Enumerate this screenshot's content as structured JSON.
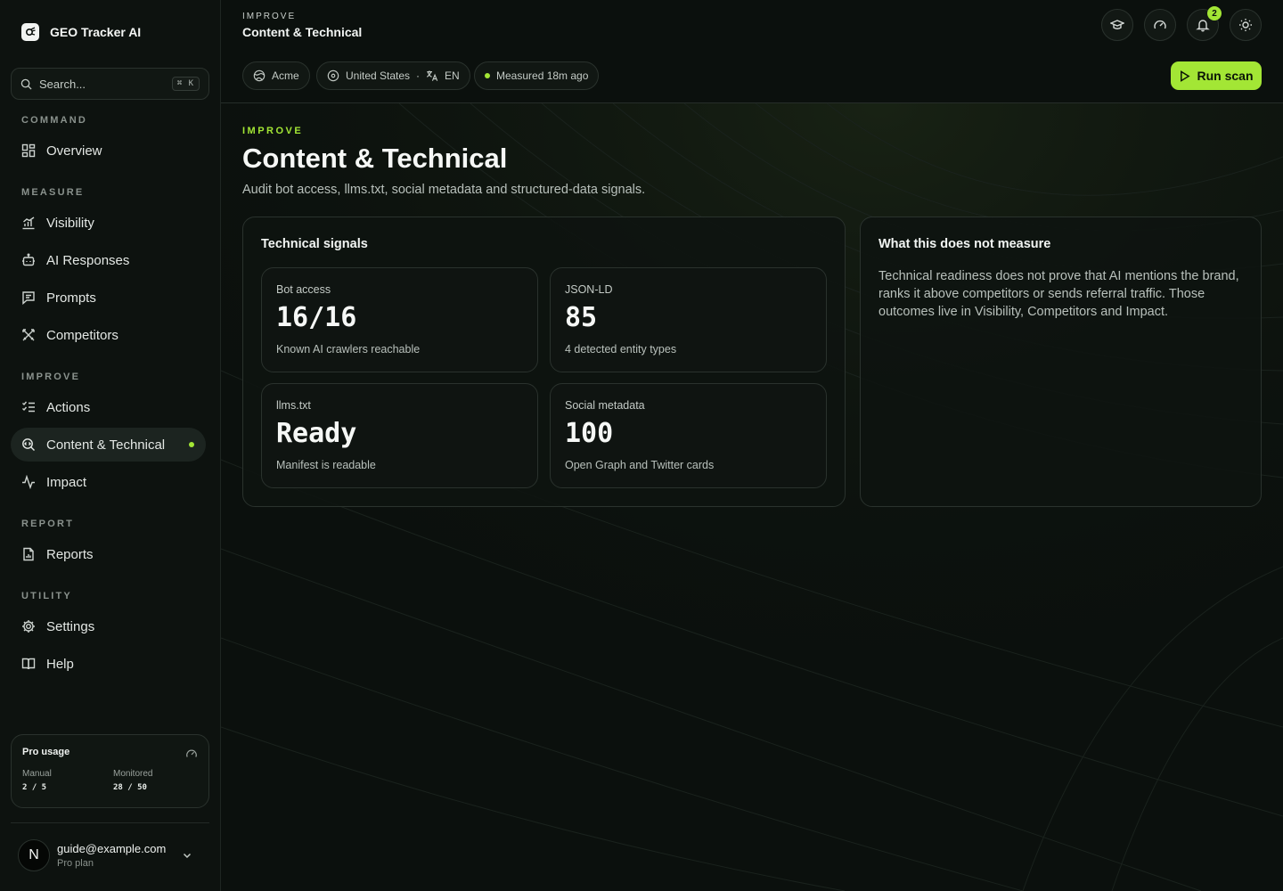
{
  "app": {
    "name": "GEO Tracker AI"
  },
  "search": {
    "placeholder": "Search...",
    "shortcut": "⌘ K"
  },
  "sidebar": {
    "sections": {
      "command": "COMMAND",
      "measure": "MEASURE",
      "improve": "IMPROVE",
      "report": "REPORT",
      "utility": "UTILITY"
    },
    "items": {
      "overview": "Overview",
      "visibility": "Visibility",
      "ai_responses": "AI Responses",
      "prompts": "Prompts",
      "competitors": "Competitors",
      "actions": "Actions",
      "content_technical": "Content & Technical",
      "impact": "Impact",
      "reports": "Reports",
      "settings": "Settings",
      "help": "Help"
    },
    "active_item": "content_technical"
  },
  "usage": {
    "title": "Pro usage",
    "manual_label": "Manual",
    "manual_value": "2 / 5",
    "monitored_label": "Monitored",
    "monitored_value": "28 / 50"
  },
  "user": {
    "initial": "N",
    "email": "guide@example.com",
    "plan": "Pro plan"
  },
  "header": {
    "eyebrow": "IMPROVE",
    "title": "Content & Technical",
    "notifications_count": "2",
    "chips": {
      "brand": "Acme",
      "country": "United States",
      "separator": "·",
      "language": "EN",
      "measured": "Measured 18m ago"
    },
    "run_scan": "Run scan"
  },
  "page": {
    "eyebrow": "IMPROVE",
    "title": "Content & Technical",
    "subtitle": "Audit bot access, llms.txt, social metadata and structured-data signals."
  },
  "signals_panel": {
    "title": "Technical signals",
    "metrics": [
      {
        "label": "Bot access",
        "value": "16/16",
        "note": "Known AI crawlers reachable"
      },
      {
        "label": "JSON-LD",
        "value": "85",
        "note": "4 detected entity types"
      },
      {
        "label": "llms.txt",
        "value": "Ready",
        "note": "Manifest is readable"
      },
      {
        "label": "Social metadata",
        "value": "100",
        "note": "Open Graph and Twitter cards"
      }
    ]
  },
  "info_panel": {
    "title": "What this does not measure",
    "text": "Technical readiness does not prove that AI mentions the brand, ranks it above competitors or sends referral traffic. Those outcomes live in Visibility, Competitors and Impact."
  },
  "colors": {
    "accent": "#a3e635",
    "background": "#0b100d",
    "sidebar": "#0d120f",
    "border": "#2a322d"
  }
}
